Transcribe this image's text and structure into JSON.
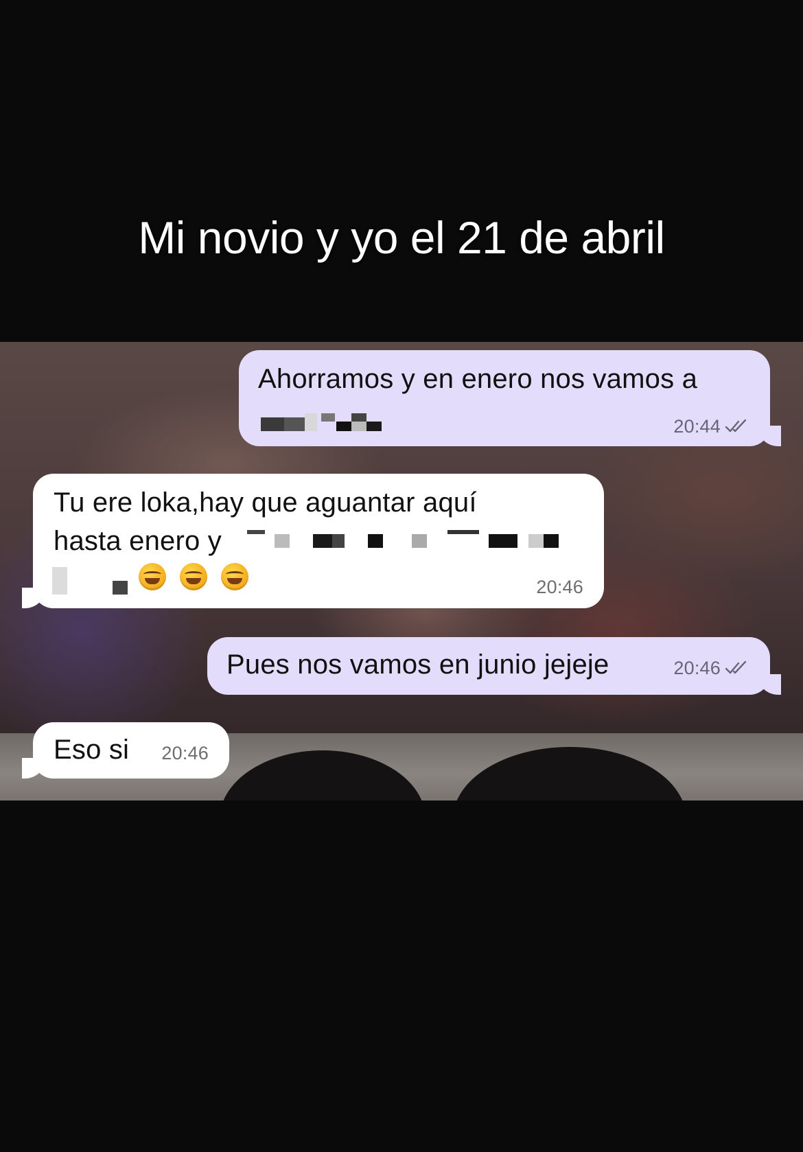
{
  "caption": "Mi novio y yo el 21 de abril",
  "messages": [
    {
      "direction": "outgoing",
      "line1": "Ahorramos y en enero nos vamos a",
      "time": "20:44",
      "read_status": "double-check"
    },
    {
      "direction": "incoming",
      "line1": "Tu ere loka,hay que aguantar aquí",
      "line2": "hasta enero y",
      "emojis": [
        "rolling-on-floor-laughing",
        "rolling-on-floor-laughing",
        "rolling-on-floor-laughing"
      ],
      "time": "20:46"
    },
    {
      "direction": "outgoing",
      "line1": "Pues nos vamos en junio jejeje",
      "time": "20:46",
      "read_status": "double-check"
    },
    {
      "direction": "incoming",
      "line1": "Eso si",
      "time": "20:46"
    }
  ],
  "colors": {
    "outgoing_bubble": "#e4dcfb",
    "incoming_bubble": "#ffffff",
    "page_background": "#0a0a0a",
    "caption_text": "#ffffff"
  },
  "icons": [
    "double-check-icon",
    "laughing-emoji-icon",
    "censored-text-pixelation"
  ]
}
